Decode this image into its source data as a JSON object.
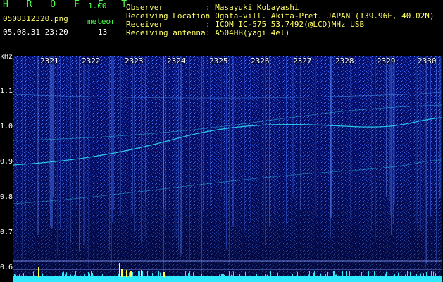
{
  "header": {
    "app_title": "H R O F F T",
    "version": "1.00",
    "filename": "0508312320.png",
    "timestamp": "05.08.31 23:20",
    "event_label": "meteor",
    "event_count": "13"
  },
  "info": {
    "labels": [
      "Observer",
      "Receiving Location",
      "Receiver",
      "Receiving antenna"
    ],
    "values": [
      ": Masayuki Kobayashi",
      ": Ogata-vill. Akita-Pref. JAPAN (139.96E, 40.02N)",
      ": ICOM IC-575 53.7492(@LCD)MHz USB",
      ": A504HB(yagi 4el)"
    ]
  },
  "freq_axis": {
    "unit": "kHz",
    "ticks": [
      "1.1",
      "1.0",
      "0.9",
      "0.8",
      "0.7",
      "0.6"
    ]
  },
  "time_axis": {
    "ticks": [
      "2321",
      "2322",
      "2323",
      "2324",
      "2325",
      "2326",
      "2327",
      "2328",
      "2329",
      "2330"
    ]
  },
  "colors": {
    "background": "#061070",
    "signal_cyan": "#2ee8ff",
    "meteor_yellow": "#ffff40",
    "label_green": "#4cff4c",
    "label_yellow": "#ffff66"
  }
}
